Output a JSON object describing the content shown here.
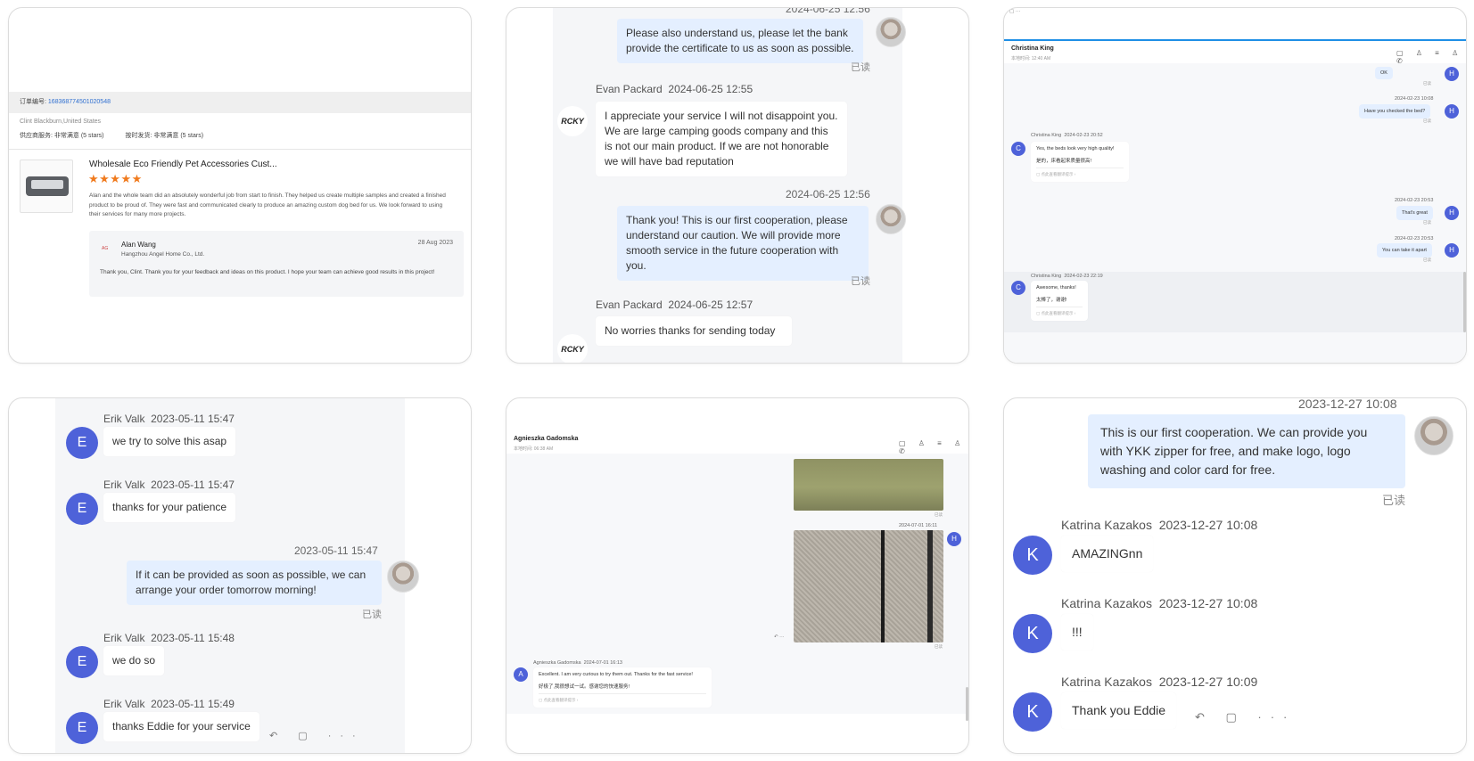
{
  "panel1": {
    "order_label": "订单编号:",
    "order_no": "1683687745010205​48",
    "buyer": "Clint Blackburn,United States",
    "rating1": "供应商服务: 非常满意  (5 stars)",
    "rating2": "按时发货: 非常满意  (5 stars)",
    "product_title": "Wholesale Eco Friendly Pet Accessories Cust...",
    "stars": "★★★★★",
    "review": "Alan and the whole team did an absolutely wonderful job from start to finish. They helped us create multiple samples and created a finished product to be proud of. They were fast and communicated clearly to produce an amazing custom dog bed for us. We look forward to using their services for many more projects.",
    "reply_logo": "AG",
    "reply_name": "Alan Wang",
    "reply_company": "Hangzhou Angel Home Co., Ltd.",
    "reply_date": "28 Aug 2023",
    "reply_text": "Thank you, Clint. Thank you for your feedback and ideas on this product. I hope your team can achieve good results in this project!"
  },
  "panel2": {
    "top_stamp": "2024-06-25 12:56",
    "msg1": "Please also understand us, please let the bank provide the certificate to us as soon as possible.",
    "read1": "已读",
    "sender2": "Evan Packard",
    "time2": "2024-06-25 12:55",
    "msg2": "I appreciate your service I will not disappoint you. We are large camping goods company and this is not our main product. If we are not honorable we will have bad reputation",
    "stamp3": "2024-06-25 12:56",
    "msg3": "Thank you! This is our first cooperation, please understand our caution. We will provide more smooth service in the future cooperation with you.",
    "read3": "已读",
    "sender4": "Evan Packard",
    "time4": "2024-06-25 12:57",
    "msg4": "No worries thanks for sending today",
    "logo": "RCKY"
  },
  "panel3": {
    "name": "Christina King",
    "sub": "本地时间: 12:40 AM",
    "icons": "▢ ♙ ≡ ♙ ✆",
    "ok": "OK",
    "read_a": "已读",
    "stamp_b": "2024-02-23 10:08",
    "msg_b": "Have you checked the bed?",
    "read_b": "已读",
    "actions_b": "↶ ▢ ···",
    "sender_c": "Christina King",
    "time_c": "2024-02-23 20:52",
    "msg_c": "Yes, the beds look very high quality!",
    "msg_c_cn": "是的，床看起来质量很高!",
    "translate_c": "▢ 点此查看翻译提示 ›",
    "stamp_d": "2024-02-23 20:53",
    "msg_d": "That's great",
    "read_d": "已读",
    "stamp_e": "2024-02-23 20:53",
    "msg_e": "You can take it apart",
    "read_e": "已读",
    "sender_f": "Christina King",
    "time_f": "2024-02-23 22:19",
    "msg_f": "Awesome, thanks!",
    "msg_f_cn": "太棒了，谢谢!",
    "translate_f": "▢ 点此查看翻译提示 ›",
    "av_h": "H",
    "av_c": "C"
  },
  "panel4": {
    "sender1": "Erik Valk",
    "time1": "2023-05-11 15:47",
    "msg1": "we try to solve this asap",
    "sender2": "Erik Valk",
    "time2": "2023-05-11 15:47",
    "msg2": "thanks for your patience",
    "stamp3": "2023-05-11 15:47",
    "msg3": "If it can be provided as soon as possible, we can arrange your order tomorrow morning!",
    "read3": "已读",
    "sender4": "Erik Valk",
    "time4": "2023-05-11 15:48",
    "msg4": "we do so",
    "sender5": "Erik Valk",
    "time5": "2023-05-11 15:49",
    "msg5": "thanks Eddie for your service",
    "actions": "↶ ▢ ···",
    "av": "E"
  },
  "panel5": {
    "name": "Agnieszka Gadomska",
    "sub": "本地时间: 06:38 AM",
    "icons": "▢ ♙ ≡ ♙ ✆",
    "read_a": "已读",
    "stamp_b": "2024-07-01 16:11",
    "read_b": "已读",
    "av_h": "H",
    "sender_c": "Agnieszka Gadomska",
    "time_c": "2024-07-01 16:13",
    "msg_c": "Excellent. I am very curious to try them out. Thanks for the fast service!",
    "msg_c_cn": "好极了,我很想试一试。感谢您的快速服务!",
    "translate_c": "▢ 点此查看翻译提示 ›",
    "av_a": "A",
    "actions": "↶ ···"
  },
  "panel6": {
    "stamp1": "2023-12-27 10:08",
    "msg1": "This is our first cooperation. We can provide you with YKK zipper for free, and make logo, logo washing and color card for free.",
    "read1": "已读",
    "sender2": "Katrina Kazakos",
    "time2": "2023-12-27 10:08",
    "msg2": "AMAZINGnn",
    "sender3": "Katrina Kazakos",
    "time3": "2023-12-27 10:08",
    "msg3": "!!!",
    "sender4": "Katrina Kazakos",
    "time4": "2023-12-27 10:09",
    "msg4": "Thank you Eddie",
    "actions": "↶ ▢ ···",
    "av": "K"
  }
}
